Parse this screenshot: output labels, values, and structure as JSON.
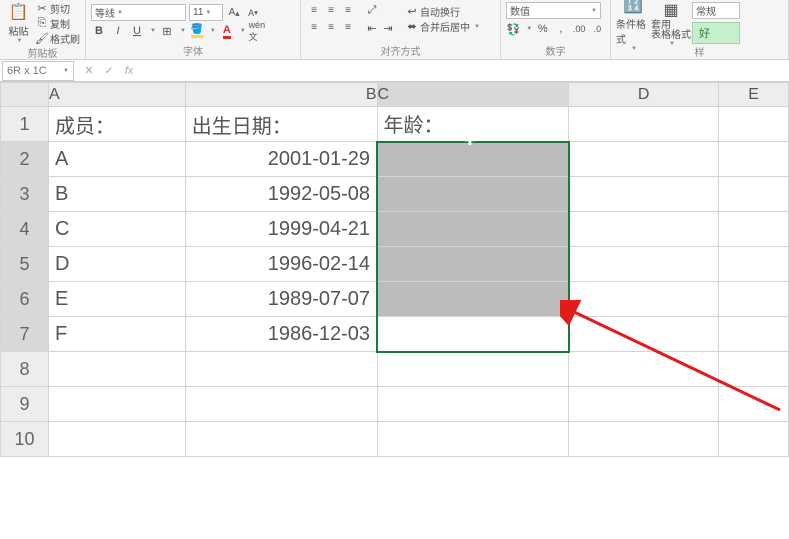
{
  "ribbon": {
    "clipboard": {
      "paste": "粘贴",
      "cut": "剪切",
      "copy": "复制",
      "format_painter": "格式刷",
      "label": "剪贴板"
    },
    "font": {
      "name": "等线",
      "size": "11",
      "bold": "B",
      "italic": "I",
      "underline": "U",
      "label": "字体"
    },
    "alignment": {
      "wrap": "自动换行",
      "merge": "合并后居中",
      "label": "对齐方式"
    },
    "number": {
      "format": "数值",
      "label": "数字"
    },
    "styles": {
      "cond": "条件格式",
      "table": "套用\n表格格式",
      "normal": "常规",
      "good": "好",
      "label": "样"
    }
  },
  "namebox": "6R x 1C",
  "fx": "fx",
  "columns": [
    "A",
    "B",
    "C",
    "D",
    "E"
  ],
  "rows": [
    "1",
    "2",
    "3",
    "4",
    "5",
    "6",
    "7",
    "8",
    "9",
    "10"
  ],
  "data": {
    "A1": "成员：",
    "B1": "出生日期：",
    "C1": "年龄：",
    "A2": "A",
    "B2": "2001-01-29",
    "A3": "B",
    "B3": "1992-05-08",
    "A4": "C",
    "B4": "1999-04-21",
    "A5": "D",
    "B5": "1996-02-14",
    "A6": "E",
    "B6": "1989-07-07",
    "A7": "F",
    "B7": "1986-12-03"
  }
}
